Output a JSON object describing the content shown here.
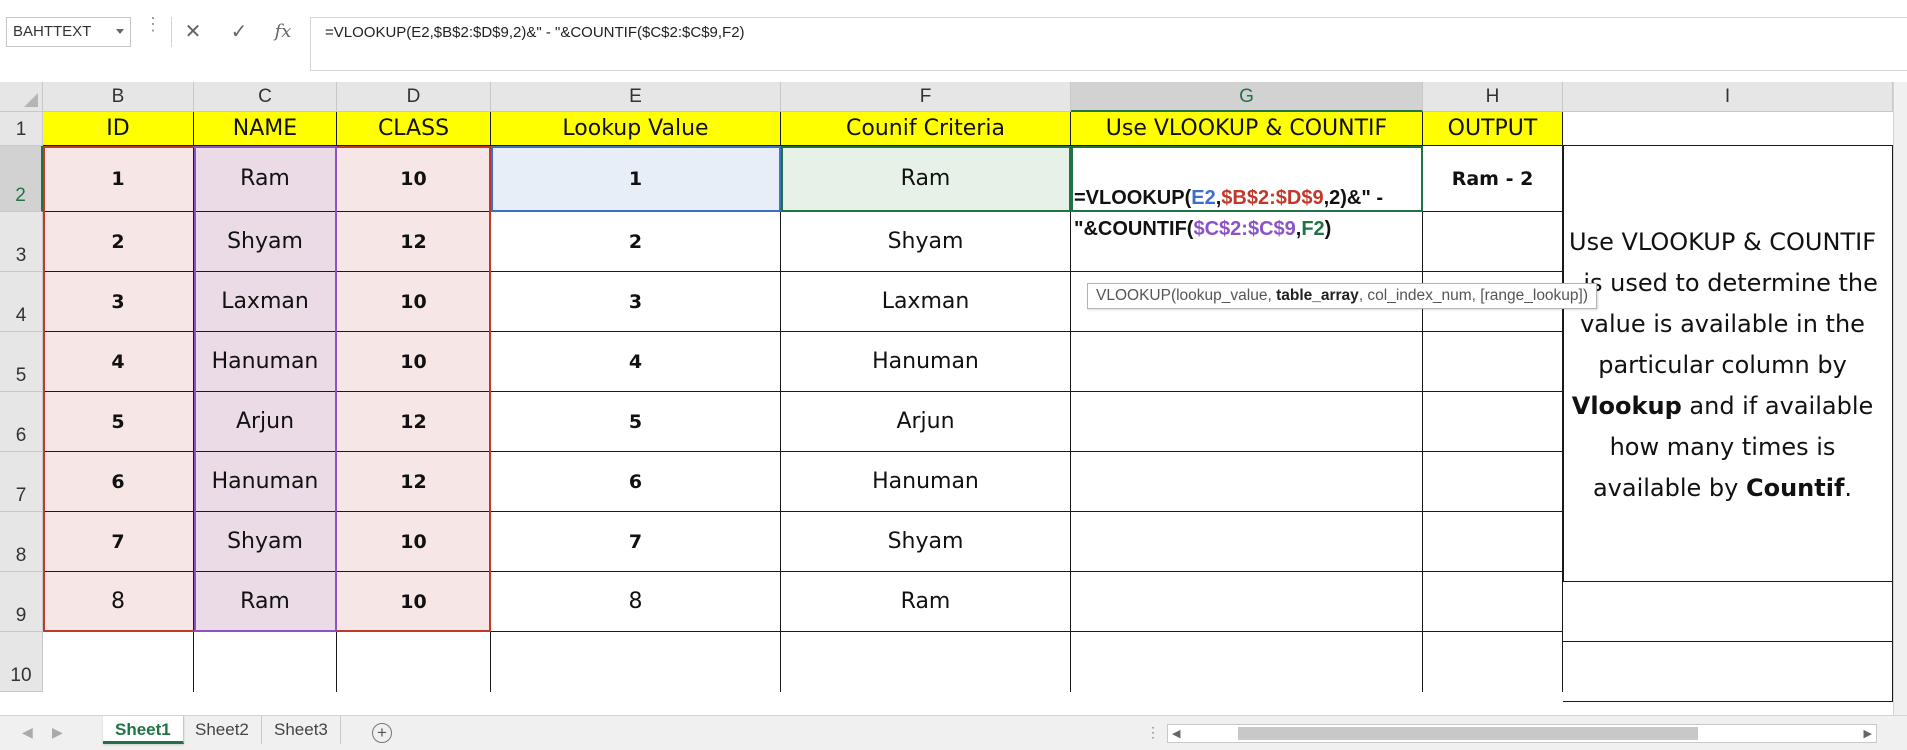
{
  "formula_bar": {
    "name_box": "BAHTTEXT",
    "cancel_icon": "cancel-icon",
    "enter_icon": "checkmark-icon",
    "function_icon": "fx-icon",
    "formula": "=VLOOKUP(E2,$B$2:$D$9,2)&\" - \"&COUNTIF($C$2:$C$9,F2)"
  },
  "columns": [
    "B",
    "C",
    "D",
    "E",
    "F",
    "G",
    "H",
    "I"
  ],
  "rows": [
    "1",
    "2",
    "3",
    "4",
    "5",
    "6",
    "7",
    "8",
    "9",
    "10"
  ],
  "headers": {
    "id": "ID",
    "name": "NAME",
    "class": "CLASS",
    "lookup": "Lookup Value",
    "criteria": "Counif Criteria",
    "use": "Use VLOOKUP & COUNTIF",
    "output": "OUTPUT"
  },
  "table": [
    {
      "id": "1",
      "name": "Ram",
      "class": "10",
      "lookup": "1",
      "criteria": "Ram"
    },
    {
      "id": "2",
      "name": "Shyam",
      "class": "12",
      "lookup": "2",
      "criteria": "Shyam"
    },
    {
      "id": "3",
      "name": "Laxman",
      "class": "10",
      "lookup": "3",
      "criteria": "Laxman"
    },
    {
      "id": "4",
      "name": "Hanuman",
      "class": "10",
      "lookup": "4",
      "criteria": "Hanuman"
    },
    {
      "id": "5",
      "name": "Arjun",
      "class": "12",
      "lookup": "5",
      "criteria": "Arjun"
    },
    {
      "id": "6",
      "name": "Hanuman",
      "class": "12",
      "lookup": "6",
      "criteria": "Hanuman"
    },
    {
      "id": "7",
      "name": "Shyam",
      "class": "10",
      "lookup": "7",
      "criteria": "Shyam"
    },
    {
      "id": "8",
      "name": "Ram",
      "class": "10",
      "lookup": "8",
      "criteria": "Ram"
    }
  ],
  "output": "Ram - 2",
  "cell_formula": {
    "p1": "=VLOOKUP(",
    "r1": "E2",
    "c1": ",",
    "r2": "$B$2:$D$9",
    "p2": ",2)&\" -",
    "p3": "\"&COUNTIF(",
    "r3": "$C$2:$C$9",
    "c2": ",",
    "r4": "F2",
    "p4": ")"
  },
  "tooltip": {
    "prefix": "VLOOKUP(lookup_value, ",
    "bold": "table_array",
    "suffix": ", col_index_num, [range_lookup])"
  },
  "note": {
    "t1": "Use VLOOKUP & COUNTIF - is used to determine the value is available in the particular column by ",
    "b1": "Vlookup",
    "t2": " and if available how many times is available by ",
    "b2": "Countif",
    "t3": "."
  },
  "sheets": [
    "Sheet1",
    "Sheet2",
    "Sheet3"
  ],
  "active_sheet": "Sheet1",
  "colors": {
    "header_fill": "#ffff00",
    "id_fill": "#f7e6e6",
    "name_fill": "#eadbe6",
    "excel_green": "#217346"
  }
}
